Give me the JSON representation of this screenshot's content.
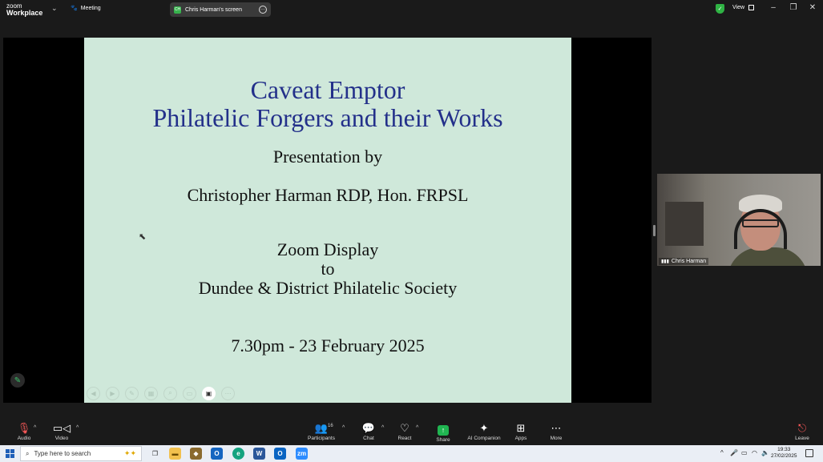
{
  "app": {
    "brand_line1": "zoom",
    "brand_line2": "Workplace",
    "meeting_label": "Meeting"
  },
  "share_pill": {
    "badge": "CH",
    "label": "Chris Harman's screen"
  },
  "header": {
    "view_label": "View",
    "minimize": "–",
    "restore": "❐",
    "close": "✕"
  },
  "slide": {
    "title_line1": "Caveat Emptor",
    "title_line2": "Philatelic Forgers and their Works",
    "line_presentation": "Presentation by",
    "line_presenter": "Christopher Harman RDP, Hon. FRPSL",
    "line_zoom": "Zoom Display",
    "line_to": "to",
    "line_society": "Dundee & District Philatelic Society",
    "line_date": "7.30pm - 23 February 2025"
  },
  "video": {
    "participant_name": "Chris Harman"
  },
  "toolbar": {
    "audio": "Audio",
    "video": "Video",
    "participants": "Participants",
    "participants_count": "16",
    "chat": "Chat",
    "react": "React",
    "share": "Share",
    "ai": "AI Companion",
    "apps": "Apps",
    "more": "More",
    "leave": "Leave"
  },
  "taskbar": {
    "search_placeholder": "Type here to search",
    "time": "19:33",
    "date": "27/02/2025"
  },
  "colors": {
    "slide_bg": "#cfe8da",
    "slide_title": "#23308a",
    "share_green": "#20b551",
    "leave_red": "#ff5a5a"
  }
}
